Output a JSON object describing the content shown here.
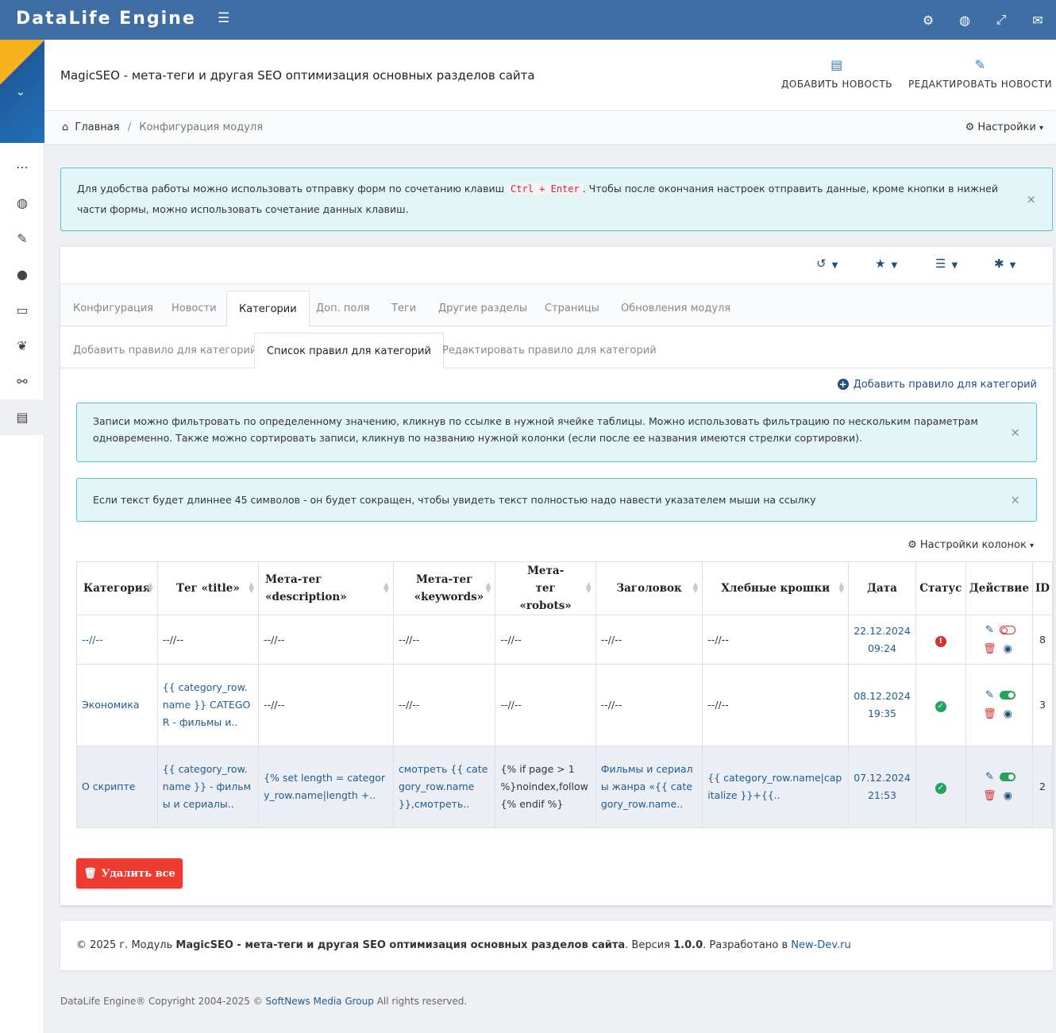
{
  "app": {
    "brand": "DataLife Engine"
  },
  "header": {
    "title": "MagicSEO - мета-теги и другая SEO оптимизация основных разделов сайта",
    "add_news": "ДОБАВИТЬ НОВОСТЬ",
    "edit_news": "РЕДАКТИРОВАТЬ НОВОСТИ"
  },
  "breadcrumb": {
    "home": "Главная",
    "sep": "/",
    "current": "Конфигурация модуля",
    "settings": "Настройки"
  },
  "alerts": {
    "hint_before": "Для удобства работы можно использовать отправку форм по сочетанию клавиш",
    "hint_kbd": "Ctrl + Enter",
    "hint_after": ". Чтобы после окончания настроек отправить данные, кроме кнопки в нижней части формы, можно использовать сочетание данных клавиш.",
    "filter": "Записи можно фильтровать по определенному значению, кликнув по ссылке в нужной ячейке таблицы. Можно использовать фильтрацию по нескольким параметрам одновременно. Также можно сортировать записи, кликнув по названию нужной колонки (если после ее названия имеются стрелки сортировки).",
    "length": "Если текст будет длиннее 45 символов - он будет сокращен, чтобы увидеть текст полностью надо навести указателем мыши на ссылку",
    "close": "×"
  },
  "tabs": [
    "Конфигурация",
    "Новости",
    "Категории",
    "Доп. поля",
    "Теги",
    "Другие разделы",
    "Страницы",
    "Обновления модуля"
  ],
  "subtabs": [
    "Добавить правило для категорий",
    "Список правил для категорий",
    "Редактировать правило для категорий"
  ],
  "add_rule": "Добавить правило для категорий",
  "column_settings": "Настройки колонок",
  "table": {
    "headers": [
      "Категория",
      "Тег «title»",
      "Мета-тег «description»",
      "Мета-тег «keywords»",
      "Мета-тег «robots»",
      "Заголовок",
      "Хлебные крошки",
      "Дата",
      "Статус",
      "Действие",
      "ID"
    ],
    "rows": [
      {
        "category": "--//--",
        "title": "--//--",
        "description": "--//--",
        "keywords": "--//--",
        "robots": "--//--",
        "heading": "--//--",
        "crumbs": "--//--",
        "date": "22.12.2024",
        "time": "09:24",
        "status": "error",
        "id": "8"
      },
      {
        "category": "Экономика",
        "title": "{{ category_row.name }} CATEGOR - фильмы и..",
        "description": "--//--",
        "keywords": "--//--",
        "robots": "--//--",
        "heading": "--//--",
        "crumbs": "--//--",
        "date": "08.12.2024",
        "time": "19:35",
        "status": "ok",
        "id": "3"
      },
      {
        "category": "О скрипте",
        "title": "{{ category_row.name }} - фильмы и сериалы..",
        "description": "{% set length = category_row.name|length +..",
        "keywords": "смотреть {{ category_row.name }},смотреть..",
        "robots": "{% if page > 1 %}noindex,follow{% endif %}",
        "heading": "Фильмы и сериалы жанра «{{ category_row.name..",
        "crumbs": "{{ category_row.name|capitalize }}+{{..",
        "date": "07.12.2024",
        "time": "21:53",
        "status": "ok",
        "id": "2"
      }
    ]
  },
  "delete_all": "Удалить все",
  "footer": {
    "prefix": "© 2025 г. Модуль",
    "module": "MagicSEO - мета-теги и другая SEO оптимизация основных разделов сайта",
    "version_label": ". Версия",
    "version": "1.0.0",
    "dev_label": ". Разработано в",
    "dev_link": "New-Dev.ru"
  },
  "copyright": {
    "prefix": "DataLife Engine® Copyright 2004-2025 ©",
    "company": "SoftNews Media Group",
    "suffix": "All rights reserved."
  }
}
